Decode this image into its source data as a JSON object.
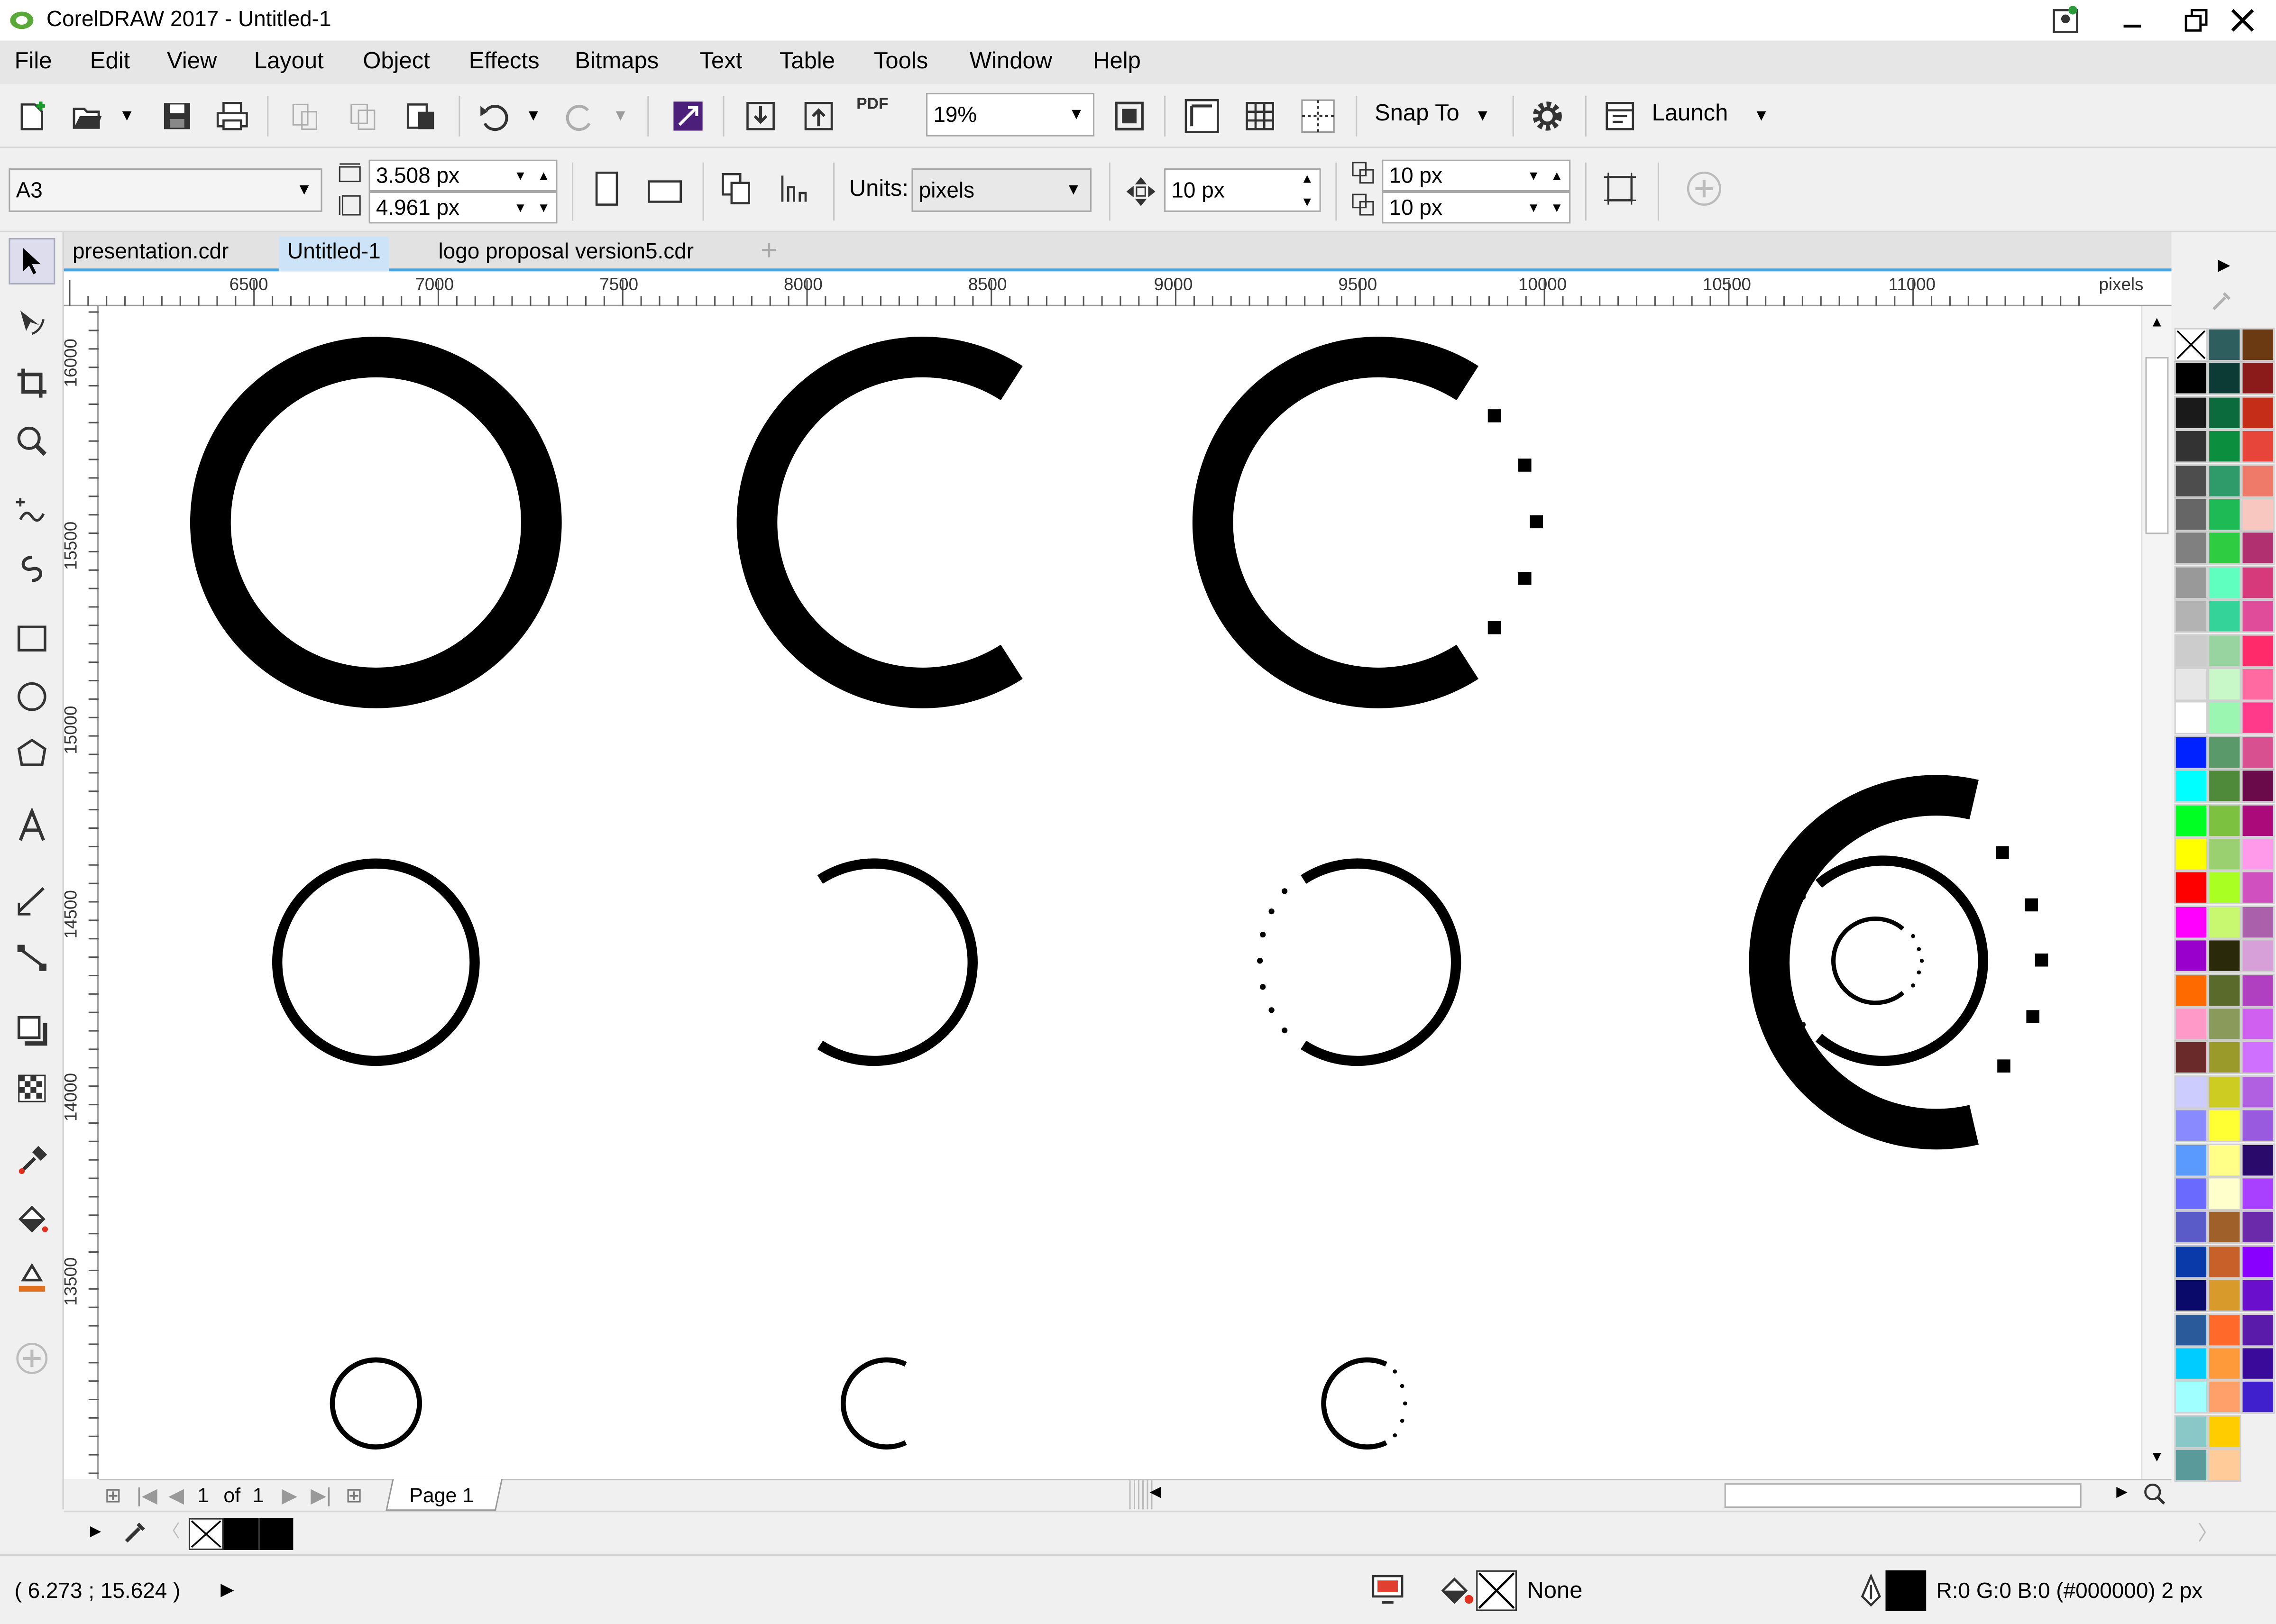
{
  "app": {
    "title": "CorelDRAW 2017 - Untitled-1"
  },
  "menu": [
    "File",
    "Edit",
    "View",
    "Layout",
    "Object",
    "Effects",
    "Bitmaps",
    "Text",
    "Table",
    "Tools",
    "Window",
    "Help"
  ],
  "toolbar": {
    "zoom": "19%",
    "snap_label": "Snap To",
    "launch_label": "Launch",
    "pdf_label": "PDF"
  },
  "property_bar": {
    "page_size": "A3",
    "width": "3.508 px",
    "height": "4.961 px",
    "units_label": "Units:",
    "units_value": "pixels",
    "nudge": "10 px",
    "dup_x": "10 px",
    "dup_y": "10 px"
  },
  "doc_tabs": [
    {
      "label": "presentation.cdr",
      "active": false
    },
    {
      "label": "Untitled-1",
      "active": true
    },
    {
      "label": "logo proposal version5.cdr",
      "active": false
    }
  ],
  "hruler": {
    "labels": [
      "6500",
      "7000",
      "7500",
      "8000",
      "8500",
      "9000",
      "9500",
      "10000",
      "10500",
      "11000"
    ],
    "unit": "pixels"
  },
  "vruler": {
    "labels": [
      "16000",
      "15500",
      "15000",
      "14500",
      "14000",
      "13500"
    ]
  },
  "page_nav": {
    "current": "1",
    "of_label": "of",
    "total": "1",
    "page_tab": "Page 1"
  },
  "status": {
    "coords": "( 6.273 ; 15.624 )",
    "fill_label": "None",
    "outline_info": "R:0 G:0 B:0 (#000000)  2 px"
  },
  "palette_colors": [
    [
      "none",
      "#2e5e5e",
      "#6b3a12"
    ],
    [
      "#000000",
      "#0c3b35",
      "#8b1a1a"
    ],
    [
      "#1a1a1a",
      "#0c6b3c",
      "#c62d19"
    ],
    [
      "#333333",
      "#0b8f3e",
      "#e8453a"
    ],
    [
      "#4d4d4d",
      "#2f9a6a",
      "#f07a6a"
    ],
    [
      "#666666",
      "#1eba55",
      "#f8c8c0"
    ],
    [
      "#808080",
      "#2ecc40",
      "#b03070"
    ],
    [
      "#999999",
      "#5fffc0",
      "#d63a7a"
    ],
    [
      "#b3b3b3",
      "#34d39a",
      "#e04b9a"
    ],
    [
      "#cccccc",
      "#98d4a0",
      "#ff2a6a"
    ],
    [
      "#e6e6e6",
      "#c8f8c8",
      "#ff6aa0"
    ],
    [
      "#ffffff",
      "#9af6b0",
      "#ff3a8a"
    ],
    [
      "#0022ff",
      "#5a9a6a",
      "#d85090"
    ],
    [
      "#00ffff",
      "#4e8a3a",
      "#6a0a4a"
    ],
    [
      "#00ff22",
      "#7cc240",
      "#aa0a7a"
    ],
    [
      "#ffff00",
      "#9ad070",
      "#ff9aea"
    ],
    [
      "#ff0000",
      "#aaff22",
      "#d050c0"
    ],
    [
      "#ff00ff",
      "#c8f870",
      "#aa60aa"
    ],
    [
      "#9900cc",
      "#2a2a0a",
      "#d8a0d8"
    ],
    [
      "#ff6a00",
      "#5a6a2a",
      "#b040c0"
    ],
    [
      "#ff9ac8",
      "#8a9a5a",
      "#d060f0"
    ],
    [
      "#6a2a2a",
      "#9a9a2a",
      "#d070ff"
    ],
    [
      "#ccccff",
      "#cccc22",
      "#b060e0"
    ],
    [
      "#8a8aff",
      "#ffff33",
      "#9a5ae0"
    ],
    [
      "#5a9aff",
      "#ffff88",
      "#2a0a6a"
    ],
    [
      "#6a6aff",
      "#ffffcc",
      "#aa40ff"
    ],
    [
      "#5a5ac8",
      "#a0602a",
      "#6a2aaa"
    ],
    [
      "#0a3aaa",
      "#c8602a",
      "#8a00ff"
    ],
    [
      "#0a0a6a",
      "#d89a2a",
      "#6a10cc"
    ],
    [
      "#2a5a9a",
      "#ff6a2a",
      "#5a1aaa"
    ],
    [
      "#00ccff",
      "#ff9a3a",
      "#3a0a9a"
    ],
    [
      "#a0ffff",
      "#ffa06a",
      "#4020cc"
    ],
    [
      "#8ac8c8",
      "#ffcc00",
      null
    ],
    [
      "#5a9a9a",
      "#ffcc99",
      null
    ]
  ],
  "colors": {
    "tab_accent": "#4aa3df",
    "active_tab": "#cde3f7",
    "menu_bg": "#e6e6e6"
  }
}
